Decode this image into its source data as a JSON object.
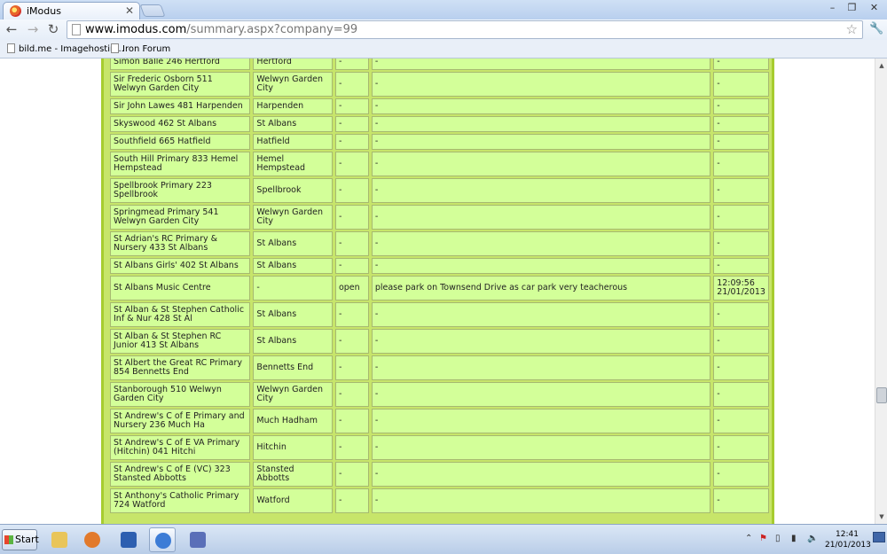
{
  "window": {
    "tab_title": "iModus",
    "controls": [
      "–",
      "❐",
      "✕"
    ]
  },
  "toolbar": {
    "url_host": "www.imodus.com",
    "url_path": "/summary.aspx?company=99"
  },
  "bookmarks": [
    "bild.me - Imagehostin...",
    "Iron Forum"
  ],
  "rows": [
    {
      "name": "Simon Balle 246 Hertford",
      "town": "Hertford",
      "status": "-",
      "note": "-",
      "time": "-"
    },
    {
      "name": "Sir Frederic Osborn 511 Welwyn Garden City",
      "town": "Welwyn Garden City",
      "status": "-",
      "note": "-",
      "time": "-"
    },
    {
      "name": "Sir John Lawes 481 Harpenden",
      "town": "Harpenden",
      "status": "-",
      "note": "-",
      "time": "-"
    },
    {
      "name": "Skyswood 462 St Albans",
      "town": "St Albans",
      "status": "-",
      "note": "-",
      "time": "-"
    },
    {
      "name": "Southfield 665 Hatfield",
      "town": "Hatfield",
      "status": "-",
      "note": "-",
      "time": "-"
    },
    {
      "name": "South Hill Primary 833 Hemel Hempstead",
      "town": "Hemel Hempstead",
      "status": "-",
      "note": "-",
      "time": "-"
    },
    {
      "name": "Spellbrook Primary 223 Spellbrook",
      "town": "Spellbrook",
      "status": "-",
      "note": "-",
      "time": "-"
    },
    {
      "name": "Springmead Primary 541 Welwyn Garden City",
      "town": "Welwyn Garden City",
      "status": "-",
      "note": "-",
      "time": "-"
    },
    {
      "name": "St Adrian's RC Primary & Nursery 433 St Albans",
      "town": "St Albans",
      "status": "-",
      "note": "-",
      "time": "-"
    },
    {
      "name": "St Albans Girls' 402 St Albans",
      "town": "St Albans",
      "status": "-",
      "note": "-",
      "time": "-"
    },
    {
      "name": "St Albans Music Centre",
      "town": "-",
      "status": "open",
      "note": "please park on Townsend Drive as car park very teacherous",
      "time": "12:09:56 21/01/2013"
    },
    {
      "name": "St Alban & St Stephen Catholic Inf & Nur 428 St Al",
      "town": "St Albans",
      "status": "-",
      "note": "-",
      "time": "-"
    },
    {
      "name": "St Alban & St Stephen RC Junior 413 St Albans",
      "town": "St Albans",
      "status": "-",
      "note": "-",
      "time": "-"
    },
    {
      "name": "St Albert the Great RC Primary 854 Bennetts End",
      "town": "Bennetts End",
      "status": "-",
      "note": "-",
      "time": "-"
    },
    {
      "name": "Stanborough 510 Welwyn Garden City",
      "town": "Welwyn Garden City",
      "status": "-",
      "note": "-",
      "time": "-"
    },
    {
      "name": "St Andrew's C of E Primary and Nursery 236 Much Ha",
      "town": "Much Hadham",
      "status": "-",
      "note": "-",
      "time": "-"
    },
    {
      "name": "St Andrew's C of E VA Primary (Hitchin) 041 Hitchi",
      "town": "Hitchin",
      "status": "-",
      "note": "-",
      "time": "-"
    },
    {
      "name": "St Andrew's C of E (VC) 323 Stansted Abbotts",
      "town": "Stansted Abbotts",
      "status": "-",
      "note": "-",
      "time": "-"
    },
    {
      "name": "St Anthony's Catholic Primary 724 Watford",
      "town": "Watford",
      "status": "-",
      "note": "-",
      "time": "-"
    }
  ],
  "taskbar": {
    "start_label": "Start",
    "time": "12:41",
    "date": "21/01/2013"
  }
}
